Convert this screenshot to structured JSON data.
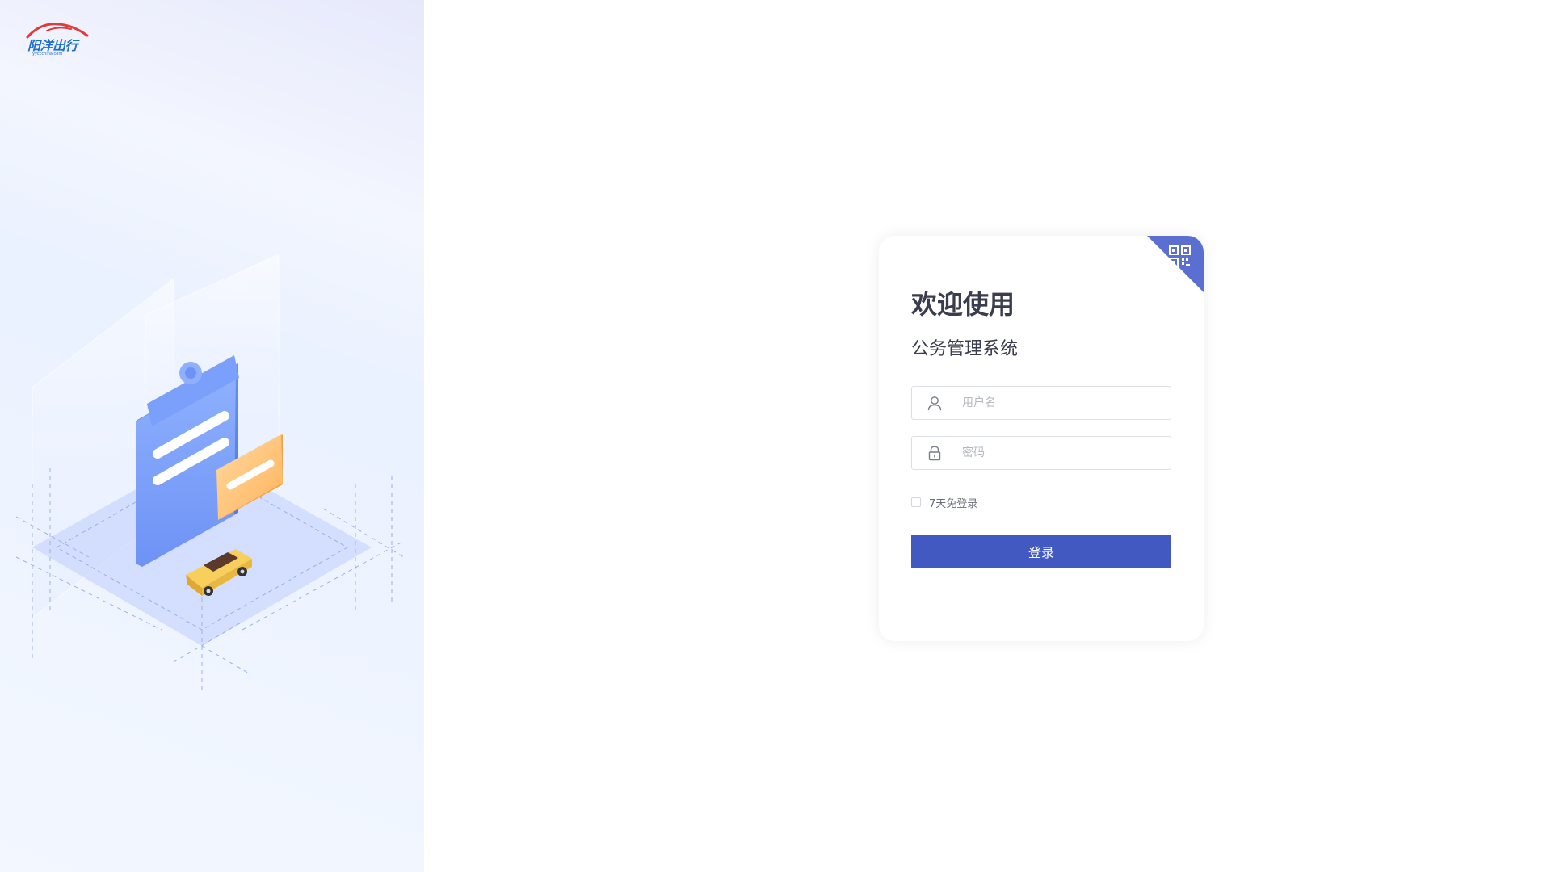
{
  "brand": {
    "logo_text": "阳洋出行",
    "logo_subtext": "yyccchina.com"
  },
  "login": {
    "welcome_title": "欢迎使用",
    "system_subtitle": "公务管理系统",
    "username_placeholder": "用户名",
    "username_value": "",
    "password_placeholder": "密码",
    "password_value": "",
    "remember_label": "7天免登录",
    "remember_checked": false,
    "submit_label": "登录"
  },
  "icons": {
    "qr_corner": "qr-code-icon",
    "username": "user-icon",
    "password": "lock-icon"
  },
  "colors": {
    "accent": "#4359c2",
    "qr_corner_bg": "#5a6fcf",
    "title_text": "#3a3d4d",
    "brand_blue": "#1f6fd1",
    "brand_red": "#e23a3a"
  }
}
